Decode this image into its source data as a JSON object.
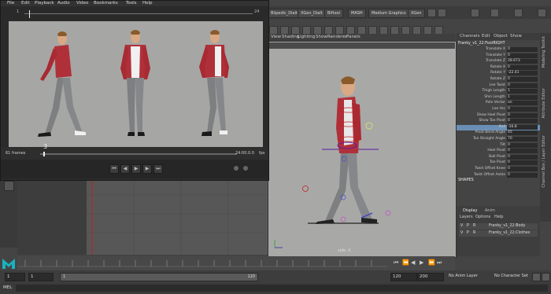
{
  "playblast": {
    "menu": [
      "File",
      "Edit",
      "Playback",
      "Audio",
      "Video",
      "Bookmarks",
      "Tools",
      "Help"
    ],
    "timeline_marks": {
      "left": "1",
      "right": "24"
    },
    "current_frame_label": "3",
    "frames_label": "61 frames",
    "timecode": "24:00.0.0",
    "fps_label": "fps"
  },
  "shelf": {
    "buttons": [
      "Biipedic_Dialt",
      "XGen_Dialt",
      "Biftool",
      "MASH",
      "Medium Graphics",
      "XGen"
    ]
  },
  "viewport": {
    "menu": [
      "View",
      "Shading",
      "Lighting",
      "Show",
      "Renderer",
      "Panels"
    ],
    "camera_label": "side -X"
  },
  "channel_box": {
    "tabs": [
      "Channels",
      "Edit",
      "Object",
      "Show"
    ],
    "node_name": "Franky_v1_22:FootRIGHT",
    "rows": [
      {
        "label": "Translate X",
        "value": "0"
      },
      {
        "label": "Translate Y",
        "value": "0"
      },
      {
        "label": "Translate Z",
        "value": "28.673"
      },
      {
        "label": "Rotate X",
        "value": "0"
      },
      {
        "label": "Rotate Y",
        "value": "-22.41"
      },
      {
        "label": "Rotate Z",
        "value": "0"
      },
      {
        "label": "Lee Twist",
        "value": "0"
      },
      {
        "label": "Thigh Length",
        "value": "1"
      },
      {
        "label": "Shin Length",
        "value": "1"
      },
      {
        "label": "Pole Vector",
        "value": "on"
      },
      {
        "label": "Lee Arc",
        "value": "0"
      },
      {
        "label": "Show Heel Pivot",
        "value": "0"
      },
      {
        "label": "Show Toe Pivot",
        "value": "0"
      },
      {
        "label": "Roll",
        "value": "-16.8"
      },
      {
        "label": "Pivot Bend Angle",
        "value": "45"
      },
      {
        "label": "Toe Straight Angle",
        "value": "70"
      },
      {
        "label": "Tilt",
        "value": "0"
      },
      {
        "label": "Heel Pivot",
        "value": "0"
      },
      {
        "label": "Ball Pivot",
        "value": "0"
      },
      {
        "label": "Toe Pivot",
        "value": "0"
      },
      {
        "label": "Twist Offset Knee",
        "value": "0"
      },
      {
        "label": "Twist Offset Ankle",
        "value": "0"
      }
    ],
    "shapes_label": "SHAPES"
  },
  "side_tabs": [
    "Modeling Toolkit",
    "Attribute Editor",
    "Channel Box / Layer Editor"
  ],
  "layers": {
    "tabs": [
      "Display",
      "Anim"
    ],
    "menu": [
      "Layers",
      "Options",
      "Help"
    ],
    "rows": [
      {
        "v": "V",
        "p": "P",
        "r": "R",
        "name": "Franky_v1_22:Body"
      },
      {
        "v": "V",
        "p": "P",
        "r": "R",
        "name": "Franky_v1_22:Clothes"
      }
    ]
  },
  "range": {
    "start": "1",
    "start2": "1",
    "end_inner": "120",
    "end": "120",
    "end2": "200",
    "anim_layer": "No Anim Layer",
    "char_set": "No Character Set"
  },
  "cmdline": {
    "label": "MEL"
  },
  "colors": {
    "selected_row": "#6a8fb5",
    "accent_red": "#d03030",
    "maya_teal": "#19b3c0"
  }
}
